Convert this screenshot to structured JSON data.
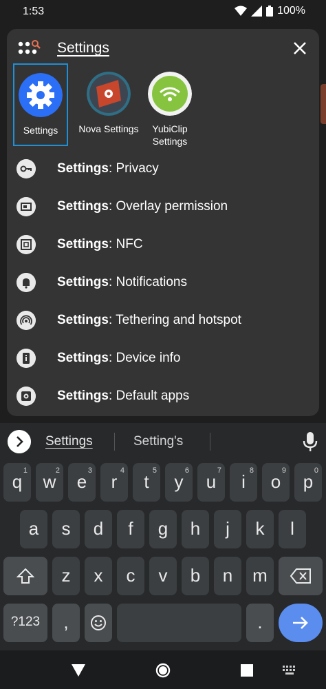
{
  "status_bar": {
    "time": "1:53",
    "battery": "100%"
  },
  "search": {
    "query": "Settings",
    "close_icon": "close-icon"
  },
  "apps": [
    {
      "label": "Settings",
      "selected": true,
      "icon": "settings-gear-icon",
      "color": "#2a6ff5"
    },
    {
      "label": "Nova Settings",
      "selected": false,
      "icon": "nova-settings-icon",
      "color": "#c8462c"
    },
    {
      "label": "YubiClip Settings",
      "selected": false,
      "icon": "yubiclip-icon",
      "color": "#86c440"
    }
  ],
  "results": [
    {
      "bold": "Settings",
      "rest": ": Privacy",
      "icon": "key-icon"
    },
    {
      "bold": "Settings",
      "rest": ": Overlay permission",
      "icon": "overlay-icon"
    },
    {
      "bold": "Settings",
      "rest": ": NFC",
      "icon": "nfc-icon"
    },
    {
      "bold": "Settings",
      "rest": ": Notifications",
      "icon": "bell-icon"
    },
    {
      "bold": "Settings",
      "rest": ": Tethering and hotspot",
      "icon": "hotspot-icon"
    },
    {
      "bold": "Settings",
      "rest": ": Device info",
      "icon": "device-info-icon"
    },
    {
      "bold": "Settings",
      "rest": ": Default apps",
      "icon": "default-apps-icon"
    }
  ],
  "keyboard": {
    "suggestions": [
      "Settings",
      "Setting's"
    ],
    "row1": [
      {
        "key": "q",
        "hint": "1"
      },
      {
        "key": "w",
        "hint": "2"
      },
      {
        "key": "e",
        "hint": "3"
      },
      {
        "key": "r",
        "hint": "4"
      },
      {
        "key": "t",
        "hint": "5"
      },
      {
        "key": "y",
        "hint": "6"
      },
      {
        "key": "u",
        "hint": "7"
      },
      {
        "key": "i",
        "hint": "8"
      },
      {
        "key": "o",
        "hint": "9"
      },
      {
        "key": "p",
        "hint": "0"
      }
    ],
    "row2": [
      "a",
      "s",
      "d",
      "f",
      "g",
      "h",
      "j",
      "k",
      "l"
    ],
    "row3": [
      "z",
      "x",
      "c",
      "v",
      "b",
      "n",
      "m"
    ],
    "symbols_label": "?123",
    "comma": ",",
    "period": "."
  },
  "colors": {
    "panel": "#343434",
    "keyboard": "#27292b",
    "accent": "#5b8def",
    "selection": "#1f8fd6"
  }
}
